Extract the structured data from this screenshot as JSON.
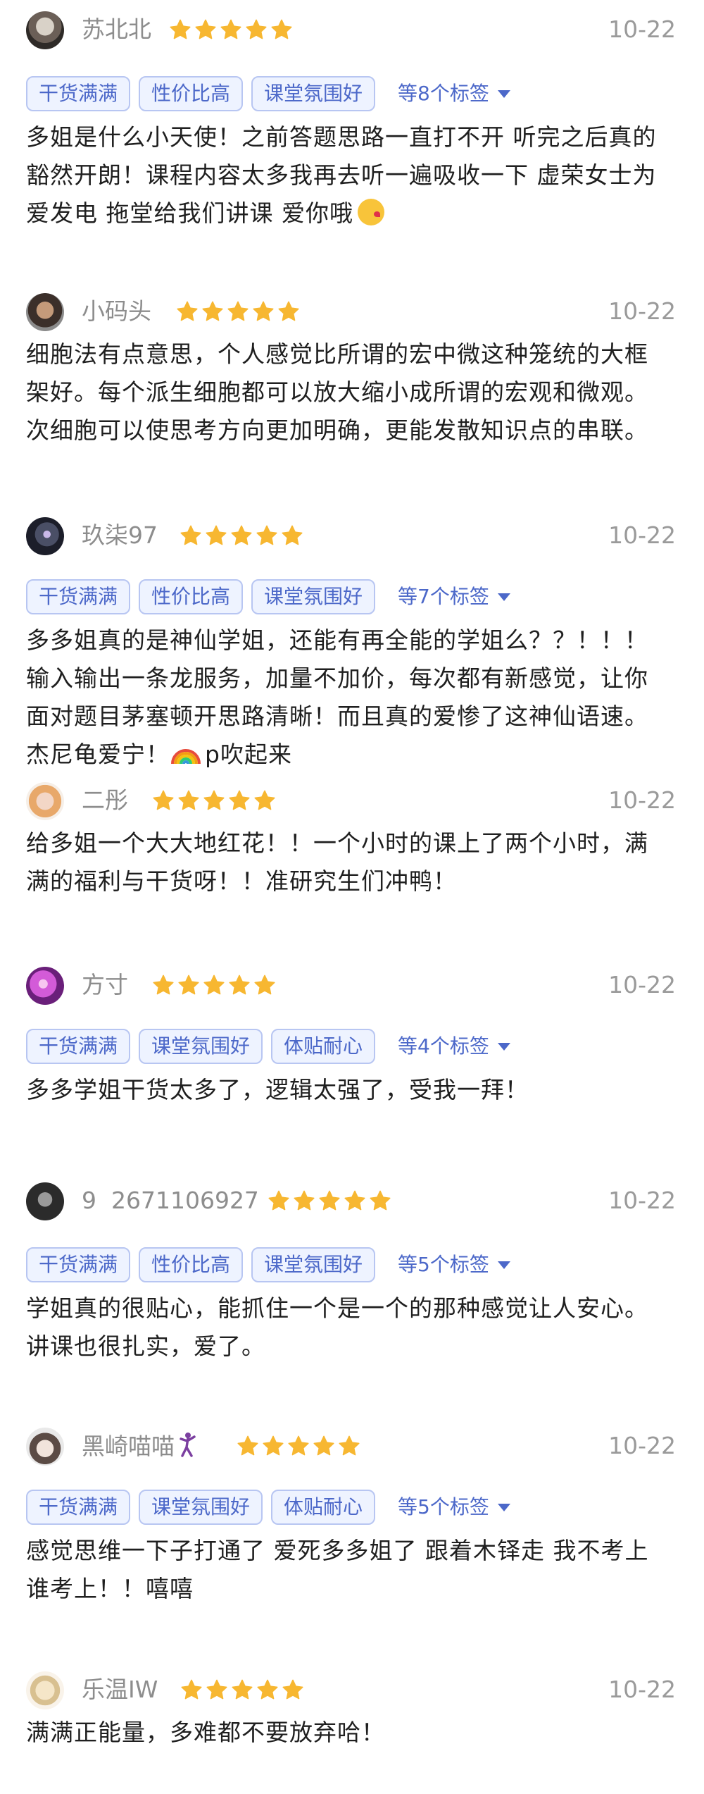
{
  "colors": {
    "star": "#f7b731",
    "tag_border": "#b8c6f2",
    "tag_bg": "#eef3ff",
    "tag_text": "#4c68c9",
    "meta_gray": "#8d8d8d"
  },
  "reviews": [
    {
      "username": "苏北北",
      "rating": 5,
      "date": "10-22",
      "tags": [
        "干货满满",
        "性价比高",
        "课堂氛围好"
      ],
      "more_tags": "等8个标签",
      "text": "多姐是什么小天使！之前答题思路一直打不开 听完之后真的\n豁然开朗！课程内容太多我再去听一遍吸收一下 虚荣女士为\n爱发电 拖堂给我们讲课 爱你哦"
    },
    {
      "username": "小码头",
      "rating": 5,
      "date": "10-22",
      "tags": [],
      "text": "细胞法有点意思，个人感觉比所谓的宏中微这种笼统的大框\n架好。每个派生细胞都可以放大缩小成所谓的宏观和微观。\n次细胞可以使思考方向更加明确，更能发散知识点的串联。"
    },
    {
      "username": "玖柒97",
      "rating": 5,
      "date": "10-22",
      "tags": [
        "干货满满",
        "性价比高",
        "课堂氛围好"
      ],
      "more_tags": "等7个标签",
      "text": "多多姐真的是神仙学姐，还能有再全能的学姐么？？！！！\n输入输出一条龙服务，加量不加价，每次都有新感觉，让你\n面对题目茅塞顿开思路清晰！而且真的爱惨了这神仙语速。\n杰尼龟爱宁！",
      "text_suffix": "p吹起来"
    },
    {
      "username": "二彤",
      "rating": 5,
      "date": "10-22",
      "tags": [],
      "text": "给多姐一个大大地红花！！一个小时的课上了两个小时，满\n满的福利与干货呀！！准研究生们冲鸭！"
    },
    {
      "username": "方寸",
      "rating": 5,
      "date": "10-22",
      "tags": [
        "干货满满",
        "课堂氛围好",
        "体贴耐心"
      ],
      "more_tags": "等4个标签",
      "text": "多多学姐干货太多了，逻辑太强了，受我一拜！"
    },
    {
      "username": "9  2671106927",
      "rating": 5,
      "date": "10-22",
      "tags": [
        "干货满满",
        "性价比高",
        "课堂氛围好"
      ],
      "more_tags": "等5个标签",
      "text": "学姐真的很贴心，能抓住一个是一个的那种感觉让人安心。\n讲课也很扎实，爱了。"
    },
    {
      "username": "黑崎喵喵",
      "rating": 5,
      "date": "10-22",
      "tags": [
        "干货满满",
        "课堂氛围好",
        "体贴耐心"
      ],
      "more_tags": "等5个标签",
      "text": "感觉思维一下子打通了 爱死多多姐了 跟着木铎走 我不考上\n谁考上！！嘻嘻"
    },
    {
      "username": "乐温IW",
      "rating": 5,
      "date": "10-22",
      "tags": [],
      "text": "满满正能量，多难都不要放弃哈！"
    }
  ]
}
